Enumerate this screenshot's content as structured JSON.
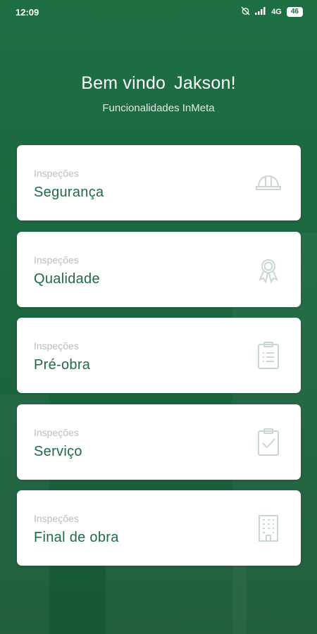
{
  "status_bar": {
    "time": "12:09",
    "network": "4G",
    "battery": "46"
  },
  "header": {
    "welcome": "Bem vindo",
    "user_name": "Jakson!",
    "subtitle": "Funcionalidades InMeta"
  },
  "cards": [
    {
      "kicker": "Inspeções",
      "title": "Segurança",
      "icon": "hard-hat-icon"
    },
    {
      "kicker": "Inspeções",
      "title": "Qualidade",
      "icon": "award-ribbon-icon"
    },
    {
      "kicker": "Inspeções",
      "title": "Pré-obra",
      "icon": "clipboard-list-icon"
    },
    {
      "kicker": "Inspeções",
      "title": "Serviço",
      "icon": "clipboard-check-icon"
    },
    {
      "kicker": "Inspeções",
      "title": "Final de obra",
      "icon": "building-icon"
    }
  ],
  "colors": {
    "background": "#1f6b43",
    "card_title": "#1f6b43",
    "icon": "#c9d8cf"
  }
}
